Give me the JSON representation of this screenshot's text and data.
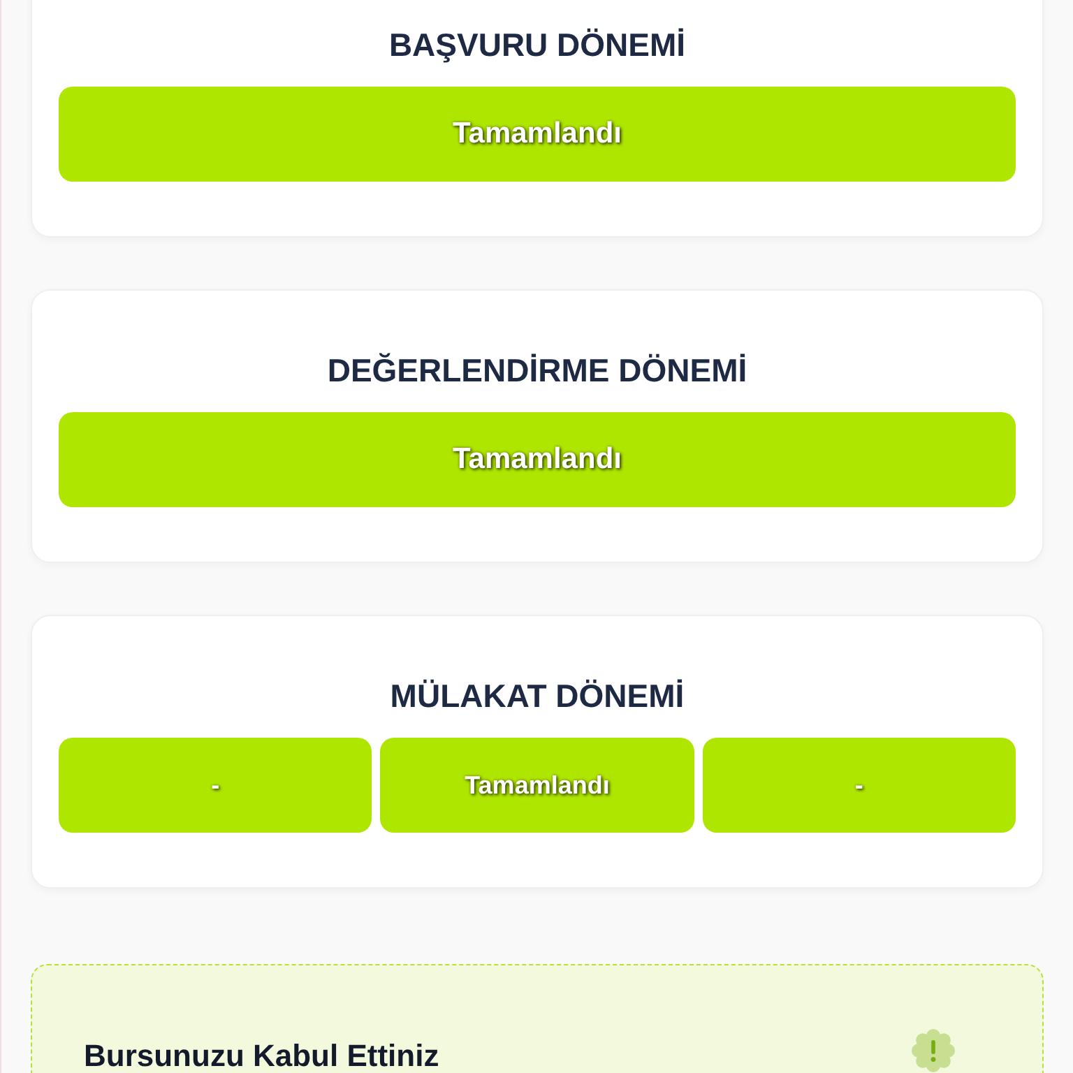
{
  "stages": [
    {
      "title": "BAŞVURU DÖNEMİ",
      "statuses": [
        {
          "label": "Tamamlandı"
        }
      ]
    },
    {
      "title": "DEĞERLENDİRME DÖNEMİ",
      "statuses": [
        {
          "label": "Tamamlandı"
        }
      ]
    },
    {
      "title": "MÜLAKAT DÖNEMİ",
      "statuses": [
        {
          "label": "-"
        },
        {
          "label": "Tamamlandı"
        },
        {
          "label": "-"
        }
      ]
    }
  ],
  "notice": {
    "title": "Bursunuzu Kabul Ettiniz"
  }
}
